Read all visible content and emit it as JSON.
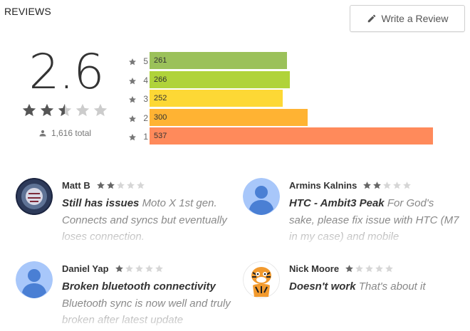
{
  "header": {
    "title": "REVIEWS",
    "write_review_label": "Write a Review",
    "write_review_icon": "pencil-icon"
  },
  "summary": {
    "score": "2.6",
    "stars_filled": 2.5,
    "total_label": "1,616 total",
    "total_icon": "person-icon"
  },
  "histogram": {
    "rows": [
      {
        "stars": "5",
        "count": "261",
        "value": 261,
        "color": "#9bc15a"
      },
      {
        "stars": "4",
        "count": "266",
        "value": 266,
        "color": "#b0d33a"
      },
      {
        "stars": "3",
        "count": "252",
        "value": 252,
        "color": "#fdd835"
      },
      {
        "stars": "2",
        "count": "300",
        "value": 300,
        "color": "#ffb333"
      },
      {
        "stars": "1",
        "count": "537",
        "value": 537,
        "color": "#ff8a5b"
      }
    ],
    "max": 537
  },
  "reviews": [
    {
      "name": "Matt B",
      "rating": 2,
      "title": "Still has issues",
      "text": "Moto X 1st gen. Connects and syncs but eventually loses connection.",
      "avatar": "photo-avatar"
    },
    {
      "name": "Armins Kalnins",
      "rating": 2,
      "title": "HTC - Ambit3 Peak",
      "text": "For God's sake, please fix issue with HTC (M7 in my case) and mobile",
      "avatar": "default-avatar"
    },
    {
      "name": "Daniel Yap",
      "rating": 1,
      "title": "Broken bluetooth connectivity",
      "text": "Bluetooth sync is now well and truly broken after latest update",
      "avatar": "default-avatar"
    },
    {
      "name": "Nick Moore",
      "rating": 1,
      "title": "Doesn't work",
      "text": "That's about it",
      "avatar": "tiger-avatar"
    }
  ],
  "colors": {
    "star_filled": "#555555",
    "star_empty": "#cccccc",
    "small_star_filled": "#666666",
    "small_star_empty": "#d6d6d6",
    "default_avatar_bg": "#a8c7fa",
    "default_avatar_fg": "#4a7fd4"
  }
}
